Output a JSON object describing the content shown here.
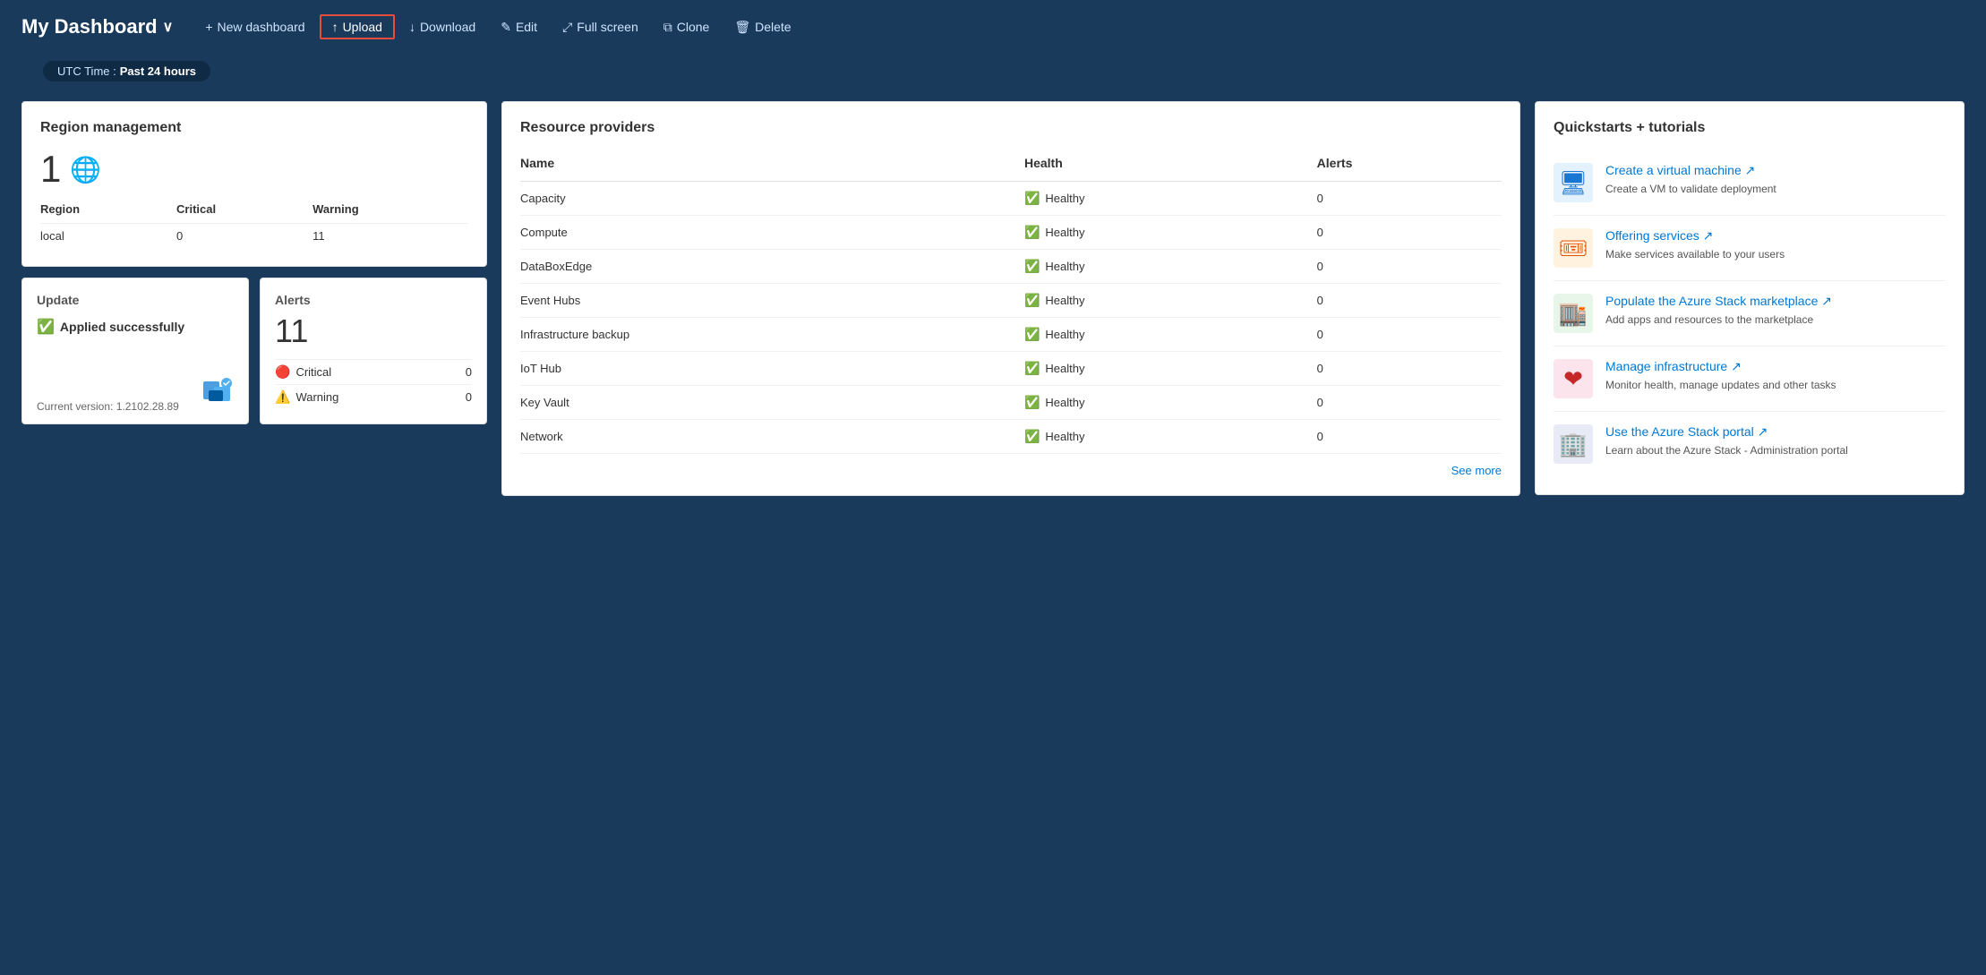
{
  "topbar": {
    "title": "My Dashboard",
    "chevron": "∨",
    "actions": [
      {
        "id": "new-dashboard",
        "icon": "+",
        "label": "New dashboard"
      },
      {
        "id": "upload",
        "icon": "↑",
        "label": "Upload"
      },
      {
        "id": "download",
        "icon": "↓",
        "label": "Download"
      },
      {
        "id": "edit",
        "icon": "✎",
        "label": "Edit"
      },
      {
        "id": "fullscreen",
        "icon": "⤢",
        "label": "Full screen"
      },
      {
        "id": "clone",
        "icon": "⧉",
        "label": "Clone"
      },
      {
        "id": "delete",
        "icon": "🗑",
        "label": "Delete"
      }
    ]
  },
  "utc_badge": {
    "prefix": "UTC Time :",
    "value": "Past 24 hours"
  },
  "region_management": {
    "title": "Region management",
    "count": "1",
    "table": {
      "headers": [
        "Region",
        "Critical",
        "Warning"
      ],
      "rows": [
        {
          "region": "local",
          "critical": "0",
          "warning": "11"
        }
      ]
    }
  },
  "update": {
    "title": "Update",
    "status": "Applied successfully",
    "version_label": "Current version:",
    "version": "1.2102.28.89"
  },
  "alerts": {
    "title": "Alerts",
    "count": "11",
    "rows": [
      {
        "icon": "critical",
        "label": "Critical",
        "value": "0"
      },
      {
        "icon": "warning",
        "label": "Warning",
        "value": "0"
      }
    ]
  },
  "resource_providers": {
    "title": "Resource providers",
    "headers": [
      "Name",
      "Health",
      "Alerts"
    ],
    "rows": [
      {
        "name": "Capacity",
        "health": "Healthy",
        "alerts": "0"
      },
      {
        "name": "Compute",
        "health": "Healthy",
        "alerts": "0"
      },
      {
        "name": "DataBoxEdge",
        "health": "Healthy",
        "alerts": "0"
      },
      {
        "name": "Event Hubs",
        "health": "Healthy",
        "alerts": "0"
      },
      {
        "name": "Infrastructure backup",
        "health": "Healthy",
        "alerts": "0"
      },
      {
        "name": "IoT Hub",
        "health": "Healthy",
        "alerts": "0"
      },
      {
        "name": "Key Vault",
        "health": "Healthy",
        "alerts": "0"
      },
      {
        "name": "Network",
        "health": "Healthy",
        "alerts": "0"
      }
    ],
    "see_more": "See more"
  },
  "quickstarts": {
    "title": "Quickstarts + tutorials",
    "items": [
      {
        "id": "create-vm",
        "icon": "🖥",
        "link": "Create a virtual machine ↗",
        "desc": "Create a VM to validate deployment"
      },
      {
        "id": "offering-services",
        "icon": "🎟",
        "link": "Offering services ↗",
        "desc": "Make services available to your users"
      },
      {
        "id": "azure-marketplace",
        "icon": "🏬",
        "link": "Populate the Azure Stack marketplace ↗",
        "desc": "Add apps and resources to the marketplace"
      },
      {
        "id": "manage-infra",
        "icon": "❤",
        "link": "Manage infrastructure ↗",
        "desc": "Monitor health, manage updates and other tasks"
      },
      {
        "id": "azure-portal",
        "icon": "🏢",
        "link": "Use the Azure Stack portal ↗",
        "desc": "Learn about the Azure Stack - Administration portal"
      }
    ]
  }
}
